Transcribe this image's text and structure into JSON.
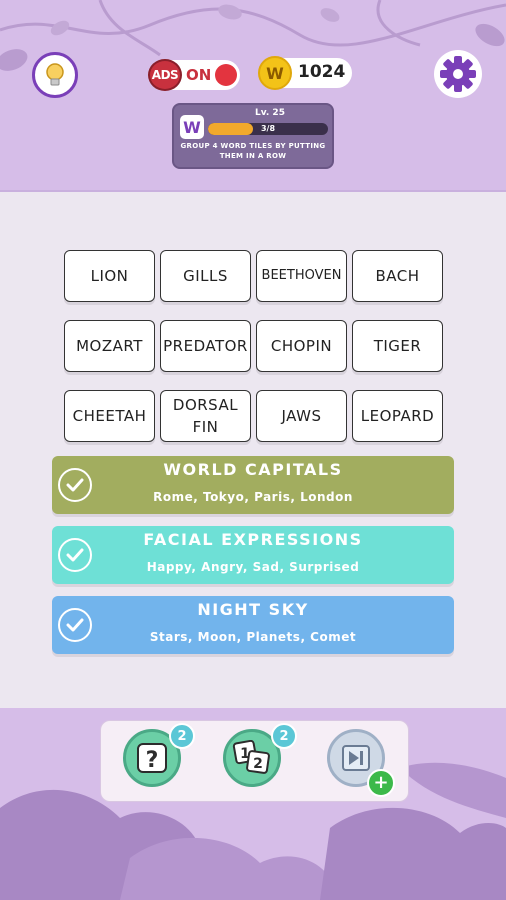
{
  "header": {
    "ads_label": "ADS",
    "ads_state": "ON",
    "coin_symbol": "W",
    "coins": "1024",
    "level_logo": "W",
    "level": "Lv. 25",
    "progress_text": "3/8",
    "progress_value": 0.375,
    "level_description": "GROUP 4 WORD TILES BY PUTTING THEM IN A ROW",
    "icons": [
      "lightbulb-icon",
      "gear-icon"
    ]
  },
  "tiles": [
    "LION",
    "GILLS",
    "BEETHOVEN",
    "BACH",
    "MOZART",
    "PREDATOR",
    "CHOPIN",
    "TIGER",
    "CHEETAH",
    "DORSAL FIN",
    "JAWS",
    "LEOPARD"
  ],
  "groups": [
    {
      "title": "WORLD CAPITALS",
      "words": "Rome, Tokyo, Paris, London",
      "color": "#a2ad5f"
    },
    {
      "title": "FACIAL EXPRESSIONS",
      "words": "Happy, Angry, Sad, Surprised",
      "color": "#6ee0d6"
    },
    {
      "title": "NIGHT SKY",
      "words": "Stars, Moon, Planets, Comet",
      "color": "#72b4ec"
    }
  ],
  "powerups": {
    "hint_symbol": "?",
    "hint_count": "2",
    "order_symbol_a": "1",
    "order_symbol_b": "2",
    "order_count": "2",
    "skip_plus": "+"
  },
  "colors": {
    "header_bg": "#d6bde8",
    "board_bg": "#ece7f0",
    "accent": "#7a3fb8"
  }
}
